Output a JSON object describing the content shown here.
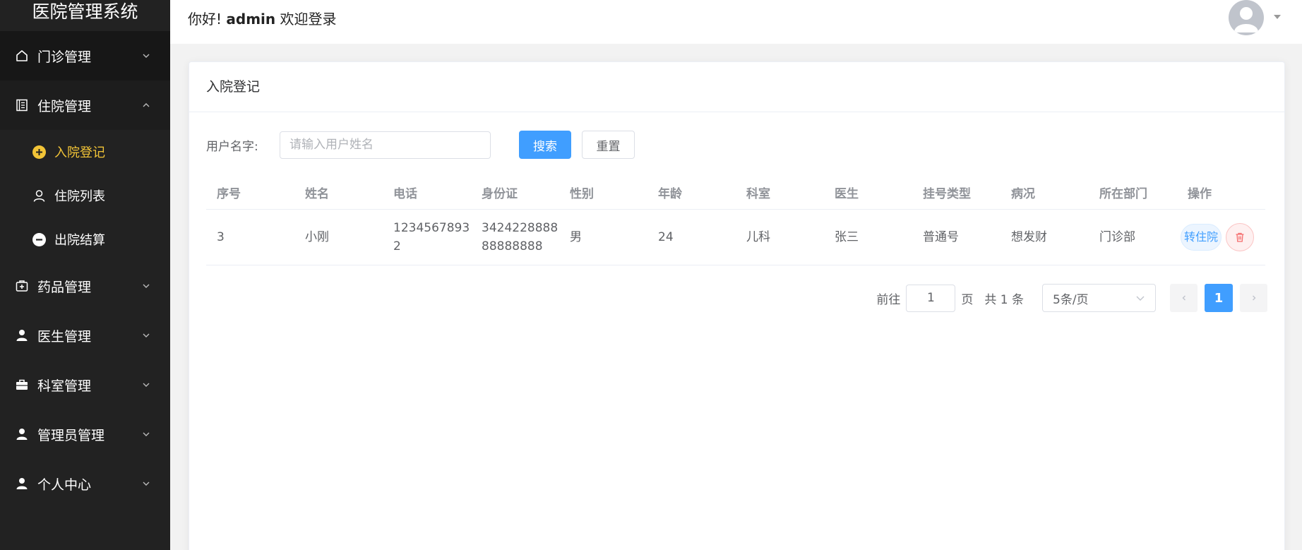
{
  "app": {
    "title": "医院管理系统"
  },
  "sidebar": {
    "items": [
      {
        "label": "门诊管理",
        "icon": "home-icon"
      },
      {
        "label": "住院管理",
        "icon": "document-icon"
      },
      {
        "label": "药品管理",
        "icon": "medkit-icon"
      },
      {
        "label": "医生管理",
        "icon": "user-icon"
      },
      {
        "label": "科室管理",
        "icon": "briefcase-icon"
      },
      {
        "label": "管理员管理",
        "icon": "user-icon"
      },
      {
        "label": "个人中心",
        "icon": "user-icon"
      }
    ],
    "submenu": [
      {
        "label": "入院登记",
        "icon": "plus-circle-icon"
      },
      {
        "label": "住院列表",
        "icon": "person-outline-icon"
      },
      {
        "label": "出院结算",
        "icon": "minus-circle-icon"
      }
    ],
    "active_color": "#f2c437",
    "background": "#222222"
  },
  "header": {
    "greeting_prefix": "你好!",
    "username": "admin",
    "greeting_suffix": "欢迎登录"
  },
  "card": {
    "title": "入院登记",
    "search": {
      "label": "用户名字:",
      "value": "",
      "placeholder": "请输入用户姓名",
      "search_button": "搜索",
      "reset_button": "重置"
    },
    "table": {
      "headers": [
        "序号",
        "姓名",
        "电话",
        "身份证",
        "性别",
        "年龄",
        "科室",
        "医生",
        "挂号类型",
        "病况",
        "所在部门",
        "操作"
      ],
      "rows": [
        {
          "id": "3",
          "name": "小刚",
          "phone": "12345678932",
          "id_card": "342422888888888888",
          "gender": "男",
          "age": "24",
          "department": "儿科",
          "doctor": "张三",
          "reg_type": "普通号",
          "condition": "想发财",
          "division": "门诊部",
          "action_transfer": "转住院"
        }
      ]
    },
    "pagination": {
      "goto_label": "前往",
      "page_value": "1",
      "page_unit": "页",
      "total": "共 1 条",
      "page_size": "5条/页",
      "current_page": "1"
    }
  },
  "colors": {
    "primary": "#409eff",
    "danger": "#f56c6c"
  }
}
